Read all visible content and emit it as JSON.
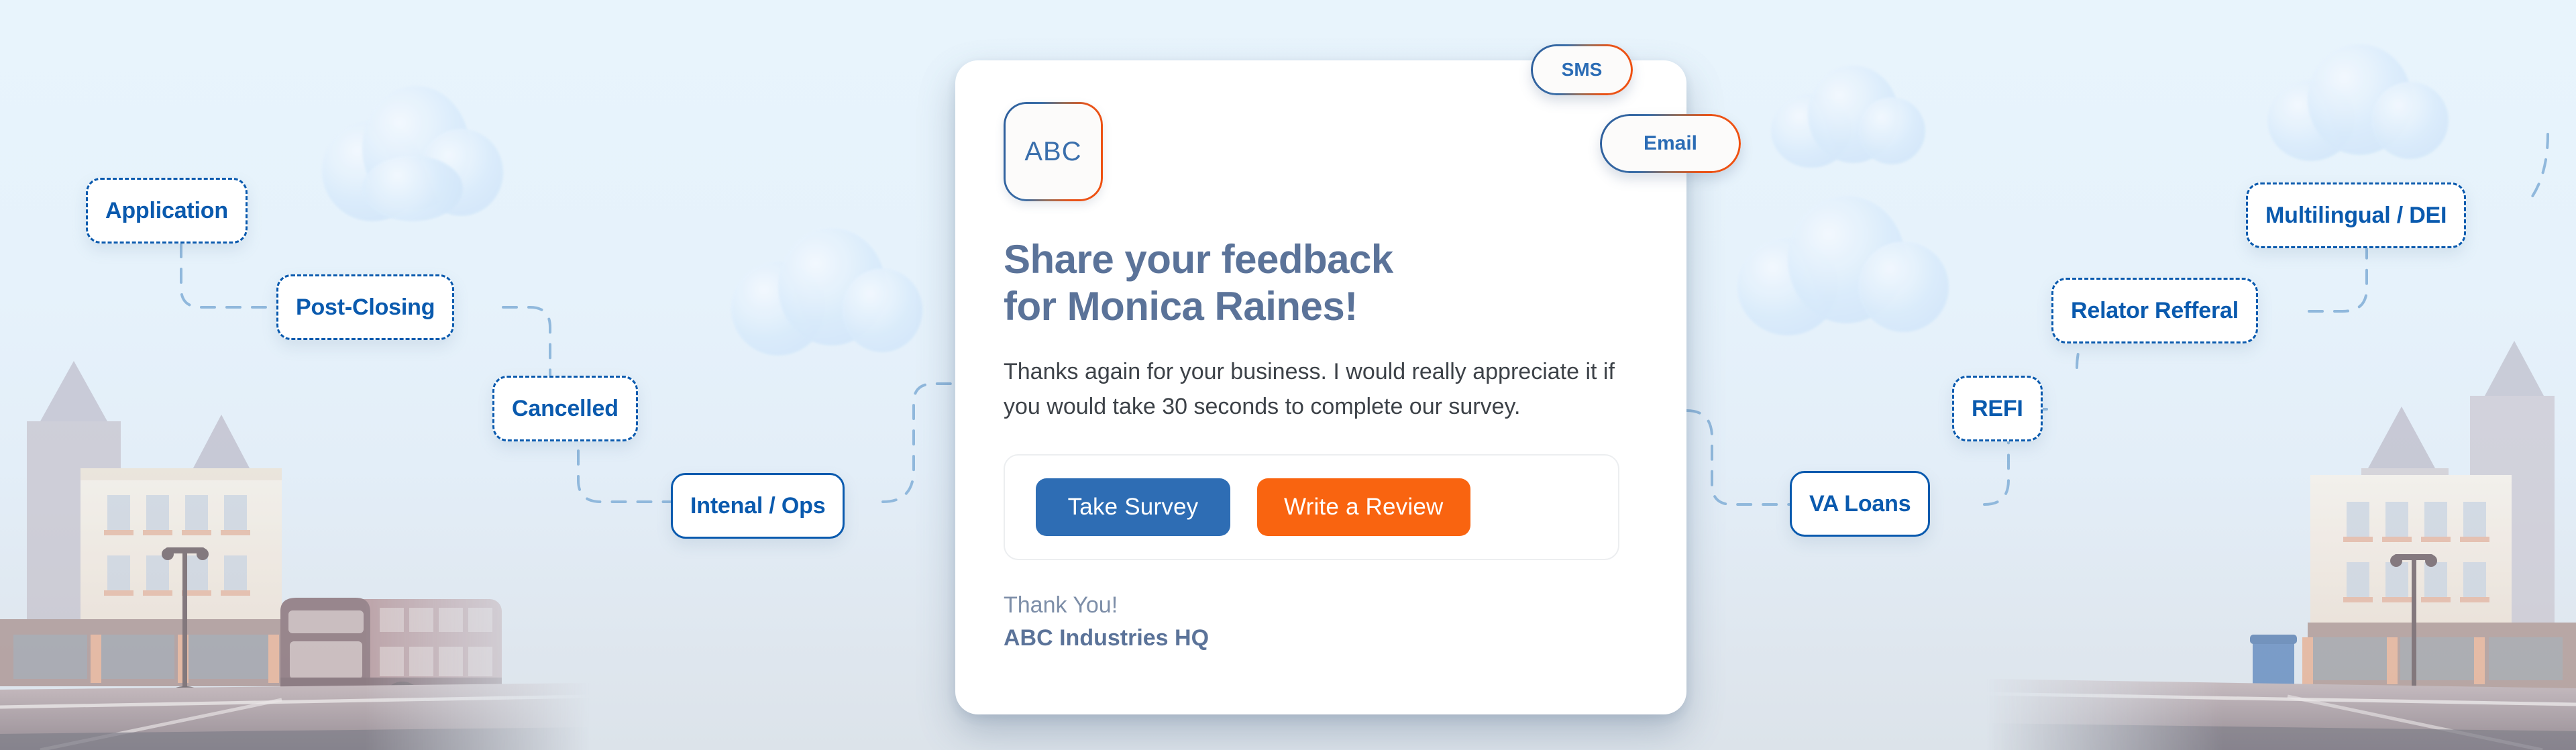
{
  "background": {
    "scene_description": "pastel city street illustration with buildings, double-decker bus, lamp posts, trash bin and road",
    "sky_color": "#e8f4fc",
    "accent_blue": "#0A5AAE",
    "accent_orange": "#F96410"
  },
  "card": {
    "logo_text": "ABC",
    "heading_line1": "Share your feedback",
    "heading_line2": "for Monica Raines!",
    "body": "Thanks again for your business. I would really appreciate it if you would take 30 seconds to complete our survey.",
    "primary_button": "Take Survey",
    "secondary_button": "Write a Review",
    "closing": "Thank You!",
    "company": "ABC Industries HQ",
    "heading_color": "#5B7399",
    "primary_button_color": "#2E6DB4",
    "secondary_button_color": "#F96410"
  },
  "channel_pills": [
    {
      "label": "SMS",
      "name": "sms"
    },
    {
      "label": "Email",
      "name": "email"
    }
  ],
  "left_chips": [
    {
      "label": "Application",
      "style": "dashed"
    },
    {
      "label": "Post-Closing",
      "style": "dashed"
    },
    {
      "label": "Cancelled",
      "style": "dashed"
    },
    {
      "label": "Intenal / Ops",
      "style": "solid"
    }
  ],
  "right_chips": [
    {
      "label": "Multilingual / DEI",
      "style": "dashed"
    },
    {
      "label": "Relator Refferal",
      "style": "dashed"
    },
    {
      "label": "REFI",
      "style": "dashed"
    },
    {
      "label": "VA Loans",
      "style": "solid"
    }
  ]
}
